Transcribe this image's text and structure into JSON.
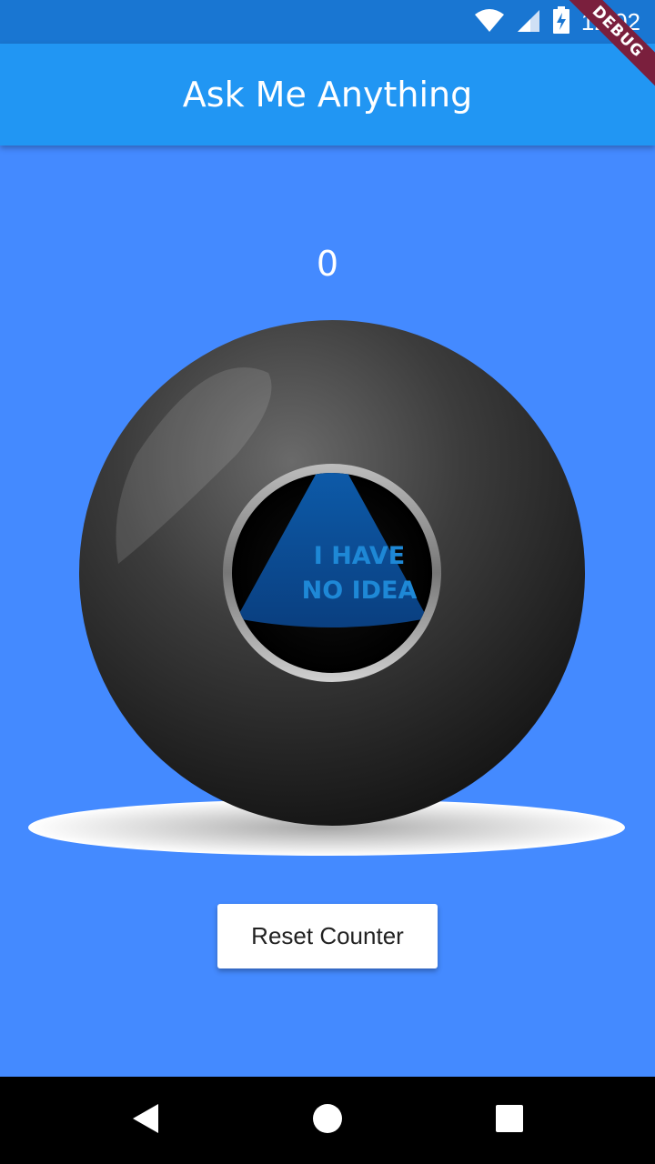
{
  "status_bar": {
    "time": "12:02",
    "icons": [
      "wifi-icon",
      "cell-signal-icon",
      "battery-charging-icon"
    ],
    "debug_banner": "DEBUG"
  },
  "app_bar": {
    "title": "Ask Me Anything"
  },
  "main": {
    "counter": "0",
    "ball_answer_line1": "I HAVE",
    "ball_answer_line2": "NO IDEA",
    "reset_button_label": "Reset Counter"
  },
  "nav_bar": {
    "icons": [
      "back-icon",
      "home-icon",
      "recents-icon"
    ]
  },
  "colors": {
    "background": "#448aff",
    "app_bar": "#2196f3",
    "status_bar": "#1976d2",
    "debug_ribbon": "#7a1f3d"
  }
}
